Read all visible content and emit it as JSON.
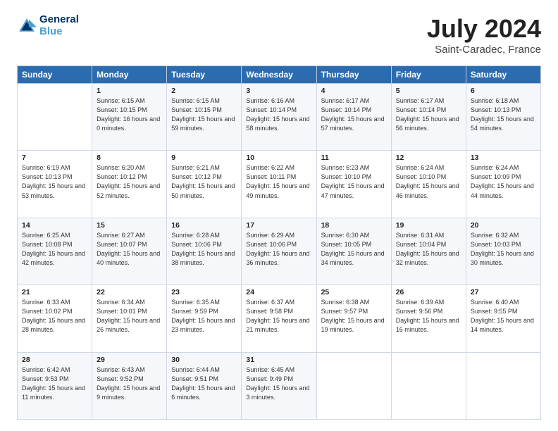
{
  "header": {
    "logo": {
      "line1": "General",
      "line2": "Blue"
    },
    "title": "July 2024",
    "subtitle": "Saint-Caradec, France"
  },
  "calendar": {
    "columns": [
      "Sunday",
      "Monday",
      "Tuesday",
      "Wednesday",
      "Thursday",
      "Friday",
      "Saturday"
    ],
    "rows": [
      [
        {
          "day": "",
          "sunrise": "",
          "sunset": "",
          "daylight": ""
        },
        {
          "day": "1",
          "sunrise": "Sunrise: 6:15 AM",
          "sunset": "Sunset: 10:15 PM",
          "daylight": "Daylight: 16 hours and 0 minutes."
        },
        {
          "day": "2",
          "sunrise": "Sunrise: 6:15 AM",
          "sunset": "Sunset: 10:15 PM",
          "daylight": "Daylight: 15 hours and 59 minutes."
        },
        {
          "day": "3",
          "sunrise": "Sunrise: 6:16 AM",
          "sunset": "Sunset: 10:14 PM",
          "daylight": "Daylight: 15 hours and 58 minutes."
        },
        {
          "day": "4",
          "sunrise": "Sunrise: 6:17 AM",
          "sunset": "Sunset: 10:14 PM",
          "daylight": "Daylight: 15 hours and 57 minutes."
        },
        {
          "day": "5",
          "sunrise": "Sunrise: 6:17 AM",
          "sunset": "Sunset: 10:14 PM",
          "daylight": "Daylight: 15 hours and 56 minutes."
        },
        {
          "day": "6",
          "sunrise": "Sunrise: 6:18 AM",
          "sunset": "Sunset: 10:13 PM",
          "daylight": "Daylight: 15 hours and 54 minutes."
        }
      ],
      [
        {
          "day": "7",
          "sunrise": "Sunrise: 6:19 AM",
          "sunset": "Sunset: 10:13 PM",
          "daylight": "Daylight: 15 hours and 53 minutes."
        },
        {
          "day": "8",
          "sunrise": "Sunrise: 6:20 AM",
          "sunset": "Sunset: 10:12 PM",
          "daylight": "Daylight: 15 hours and 52 minutes."
        },
        {
          "day": "9",
          "sunrise": "Sunrise: 6:21 AM",
          "sunset": "Sunset: 10:12 PM",
          "daylight": "Daylight: 15 hours and 50 minutes."
        },
        {
          "day": "10",
          "sunrise": "Sunrise: 6:22 AM",
          "sunset": "Sunset: 10:11 PM",
          "daylight": "Daylight: 15 hours and 49 minutes."
        },
        {
          "day": "11",
          "sunrise": "Sunrise: 6:23 AM",
          "sunset": "Sunset: 10:10 PM",
          "daylight": "Daylight: 15 hours and 47 minutes."
        },
        {
          "day": "12",
          "sunrise": "Sunrise: 6:24 AM",
          "sunset": "Sunset: 10:10 PM",
          "daylight": "Daylight: 15 hours and 46 minutes."
        },
        {
          "day": "13",
          "sunrise": "Sunrise: 6:24 AM",
          "sunset": "Sunset: 10:09 PM",
          "daylight": "Daylight: 15 hours and 44 minutes."
        }
      ],
      [
        {
          "day": "14",
          "sunrise": "Sunrise: 6:25 AM",
          "sunset": "Sunset: 10:08 PM",
          "daylight": "Daylight: 15 hours and 42 minutes."
        },
        {
          "day": "15",
          "sunrise": "Sunrise: 6:27 AM",
          "sunset": "Sunset: 10:07 PM",
          "daylight": "Daylight: 15 hours and 40 minutes."
        },
        {
          "day": "16",
          "sunrise": "Sunrise: 6:28 AM",
          "sunset": "Sunset: 10:06 PM",
          "daylight": "Daylight: 15 hours and 38 minutes."
        },
        {
          "day": "17",
          "sunrise": "Sunrise: 6:29 AM",
          "sunset": "Sunset: 10:06 PM",
          "daylight": "Daylight: 15 hours and 36 minutes."
        },
        {
          "day": "18",
          "sunrise": "Sunrise: 6:30 AM",
          "sunset": "Sunset: 10:05 PM",
          "daylight": "Daylight: 15 hours and 34 minutes."
        },
        {
          "day": "19",
          "sunrise": "Sunrise: 6:31 AM",
          "sunset": "Sunset: 10:04 PM",
          "daylight": "Daylight: 15 hours and 32 minutes."
        },
        {
          "day": "20",
          "sunrise": "Sunrise: 6:32 AM",
          "sunset": "Sunset: 10:03 PM",
          "daylight": "Daylight: 15 hours and 30 minutes."
        }
      ],
      [
        {
          "day": "21",
          "sunrise": "Sunrise: 6:33 AM",
          "sunset": "Sunset: 10:02 PM",
          "daylight": "Daylight: 15 hours and 28 minutes."
        },
        {
          "day": "22",
          "sunrise": "Sunrise: 6:34 AM",
          "sunset": "Sunset: 10:01 PM",
          "daylight": "Daylight: 15 hours and 26 minutes."
        },
        {
          "day": "23",
          "sunrise": "Sunrise: 6:35 AM",
          "sunset": "Sunset: 9:59 PM",
          "daylight": "Daylight: 15 hours and 23 minutes."
        },
        {
          "day": "24",
          "sunrise": "Sunrise: 6:37 AM",
          "sunset": "Sunset: 9:58 PM",
          "daylight": "Daylight: 15 hours and 21 minutes."
        },
        {
          "day": "25",
          "sunrise": "Sunrise: 6:38 AM",
          "sunset": "Sunset: 9:57 PM",
          "daylight": "Daylight: 15 hours and 19 minutes."
        },
        {
          "day": "26",
          "sunrise": "Sunrise: 6:39 AM",
          "sunset": "Sunset: 9:56 PM",
          "daylight": "Daylight: 15 hours and 16 minutes."
        },
        {
          "day": "27",
          "sunrise": "Sunrise: 6:40 AM",
          "sunset": "Sunset: 9:55 PM",
          "daylight": "Daylight: 15 hours and 14 minutes."
        }
      ],
      [
        {
          "day": "28",
          "sunrise": "Sunrise: 6:42 AM",
          "sunset": "Sunset: 9:53 PM",
          "daylight": "Daylight: 15 hours and 11 minutes."
        },
        {
          "day": "29",
          "sunrise": "Sunrise: 6:43 AM",
          "sunset": "Sunset: 9:52 PM",
          "daylight": "Daylight: 15 hours and 9 minutes."
        },
        {
          "day": "30",
          "sunrise": "Sunrise: 6:44 AM",
          "sunset": "Sunset: 9:51 PM",
          "daylight": "Daylight: 15 hours and 6 minutes."
        },
        {
          "day": "31",
          "sunrise": "Sunrise: 6:45 AM",
          "sunset": "Sunset: 9:49 PM",
          "daylight": "Daylight: 15 hours and 3 minutes."
        },
        {
          "day": "",
          "sunrise": "",
          "sunset": "",
          "daylight": ""
        },
        {
          "day": "",
          "sunrise": "",
          "sunset": "",
          "daylight": ""
        },
        {
          "day": "",
          "sunrise": "",
          "sunset": "",
          "daylight": ""
        }
      ]
    ]
  }
}
